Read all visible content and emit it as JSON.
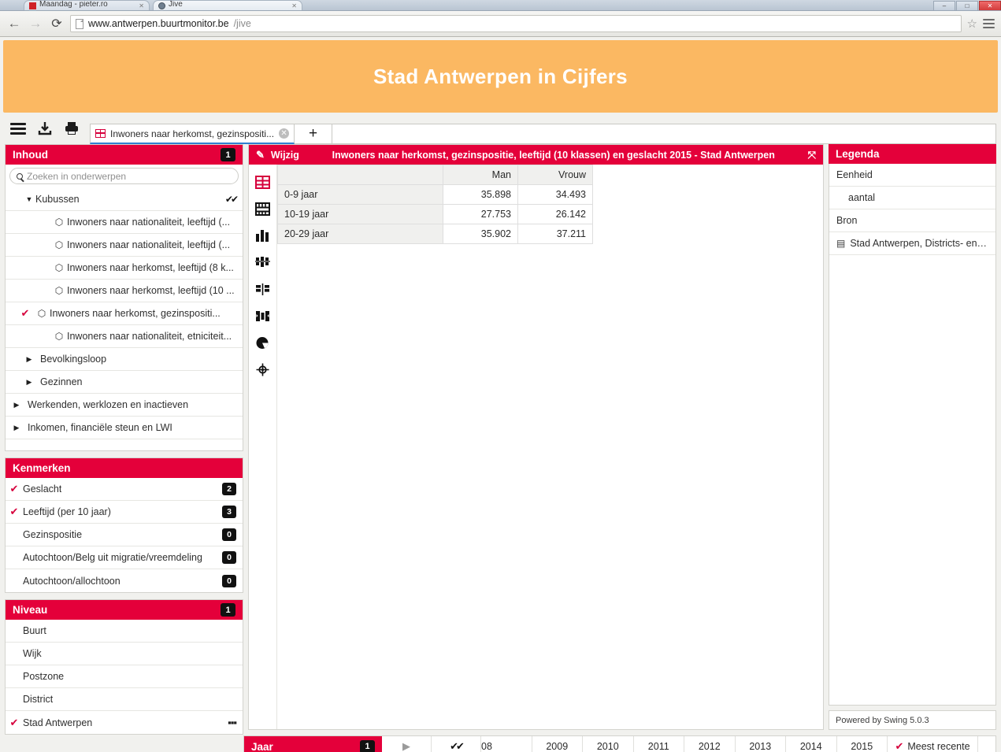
{
  "browser": {
    "tabs": [
      {
        "title": "Maandag - pieter.ro",
        "favicon": "red-square-icon"
      },
      {
        "title": "Jive",
        "favicon": "globe-icon"
      }
    ],
    "window_buttons": [
      "–",
      "□",
      "✕"
    ],
    "back_icon": "back-arrow-icon",
    "forward_icon": "forward-arrow-icon",
    "reload_icon": "reload-icon",
    "url_main": "www.antwerpen.buurtmonitor.be",
    "url_path": "/jive",
    "bookmark_icon": "star-icon",
    "menu_icon": "hamburger-menu-icon"
  },
  "banner": {
    "title": "Stad Antwerpen in Cijfers",
    "color": "#fbb862"
  },
  "apptoolbar": {
    "menu_icon": "hamburger-menu-icon",
    "download_icon": "download-icon",
    "print_icon": "print-icon",
    "tab_label": "Inwoners naar herkomst, gezinspositi...",
    "tab_icon": "table-icon",
    "tab_close_icon": "close-icon",
    "add_tab_label": "+"
  },
  "sidebar": {
    "content": {
      "title": "Inhoud",
      "badge": "1",
      "search_placeholder": "Zoeken in onderwerpen",
      "search_value": "",
      "search_icon": "search-icon",
      "tree": [
        {
          "label": "Kubussen",
          "level": 1,
          "caret": "▼",
          "checked": false,
          "cube": false,
          "dblcheck": true
        },
        {
          "label": "Inwoners naar nationaliteit, leeftijd (...",
          "level": 2,
          "caret": "",
          "checked": false,
          "cube": true,
          "dblcheck": false
        },
        {
          "label": "Inwoners naar nationaliteit, leeftijd (...",
          "level": 2,
          "caret": "",
          "checked": false,
          "cube": true,
          "dblcheck": false
        },
        {
          "label": "Inwoners naar herkomst, leeftijd (8 k...",
          "level": 2,
          "caret": "",
          "checked": false,
          "cube": true,
          "dblcheck": false
        },
        {
          "label": "Inwoners naar herkomst, leeftijd (10 ...",
          "level": 2,
          "caret": "",
          "checked": false,
          "cube": true,
          "dblcheck": false
        },
        {
          "label": "Inwoners naar herkomst, gezinspositi...",
          "level": 2,
          "caret": "",
          "checked": true,
          "cube": true,
          "dblcheck": false
        },
        {
          "label": "Inwoners naar nationaliteit, etniciteit...",
          "level": 2,
          "caret": "",
          "checked": false,
          "cube": true,
          "dblcheck": false
        },
        {
          "label": "Bevolkingsloop",
          "level": 1,
          "caret": "▶",
          "checked": false,
          "cube": false,
          "dblcheck": false
        },
        {
          "label": "Gezinnen",
          "level": 1,
          "caret": "▶",
          "checked": false,
          "cube": false,
          "dblcheck": false
        },
        {
          "label": "Werkenden, werklozen en inactieven",
          "level": 0,
          "caret": "▶",
          "checked": false,
          "cube": false,
          "dblcheck": false
        },
        {
          "label": "Inkomen, financiële steun en LWI",
          "level": 0,
          "caret": "▶",
          "checked": false,
          "cube": false,
          "dblcheck": false
        }
      ]
    },
    "features": {
      "title": "Kenmerken",
      "items": [
        {
          "label": "Geslacht",
          "badge": "2",
          "checked": true
        },
        {
          "label": "Leeftijd (per 10 jaar)",
          "badge": "3",
          "checked": true
        },
        {
          "label": "Gezinspositie",
          "badge": "0",
          "checked": false
        },
        {
          "label": "Autochtoon/Belg uit migratie/vreemdeling",
          "badge": "0",
          "checked": false
        },
        {
          "label": "Autochtoon/allochtoon",
          "badge": "0",
          "checked": false
        }
      ]
    },
    "level": {
      "title": "Niveau",
      "badge": "1",
      "items": [
        {
          "label": "Buurt",
          "checked": false,
          "dots": false
        },
        {
          "label": "Wijk",
          "checked": false,
          "dots": false
        },
        {
          "label": "Postzone",
          "checked": false,
          "dots": false
        },
        {
          "label": "District",
          "checked": false,
          "dots": false
        },
        {
          "label": "Stad Antwerpen",
          "checked": true,
          "dots": true
        }
      ]
    }
  },
  "main": {
    "edit_label": "Wijzig",
    "edit_icon": "pencil-icon",
    "title": "Inwoners naar herkomst, gezinspositie, leeftijd (10 klassen) en geslacht 2015 - Stad Antwerpen",
    "expand_icon": "expand-icon",
    "viz_buttons": [
      {
        "name": "table-view-icon",
        "active": true
      },
      {
        "name": "pivot-table-icon",
        "active": false
      },
      {
        "name": "bar-chart-icon",
        "active": false
      },
      {
        "name": "stacked-bar-chart-icon",
        "active": false
      },
      {
        "name": "grouped-bar-chart-icon",
        "active": false
      },
      {
        "name": "population-pyramid-icon",
        "active": false
      },
      {
        "name": "pie-chart-icon",
        "active": false
      },
      {
        "name": "map-view-icon",
        "active": false
      }
    ]
  },
  "chart_data": {
    "type": "table",
    "title": "Inwoners naar herkomst, gezinspositie, leeftijd (10 klassen) en geslacht 2015 - Stad Antwerpen",
    "corner_label": "",
    "categories": [
      "0-9 jaar",
      "10-19 jaar",
      "20-29 jaar"
    ],
    "columns": [
      "Man",
      "Vrouw"
    ],
    "series": [
      {
        "name": "Man",
        "values": [
          "35.898",
          "27.753",
          "35.902"
        ]
      },
      {
        "name": "Vrouw",
        "values": [
          "34.493",
          "26.142",
          "37.211"
        ]
      }
    ],
    "unit": "aantal"
  },
  "legend": {
    "title": "Legenda",
    "unit_header": "Eenheid",
    "unit_value": "aantal",
    "source_header": "Bron",
    "source_value": "Stad Antwerpen, Districts- en L...",
    "source_icon": "book-icon",
    "powered_by": "Powered by Swing 5.0.3"
  },
  "yearbar": {
    "title": "Jaar",
    "badge": "1",
    "play_icon": "play-icon",
    "selectall_icon": "double-check-icon",
    "years": [
      "08",
      "2009",
      "2010",
      "2011",
      "2012",
      "2013",
      "2014",
      "2015"
    ],
    "most_recent_label": "Meest recente",
    "most_recent_checked": true
  }
}
